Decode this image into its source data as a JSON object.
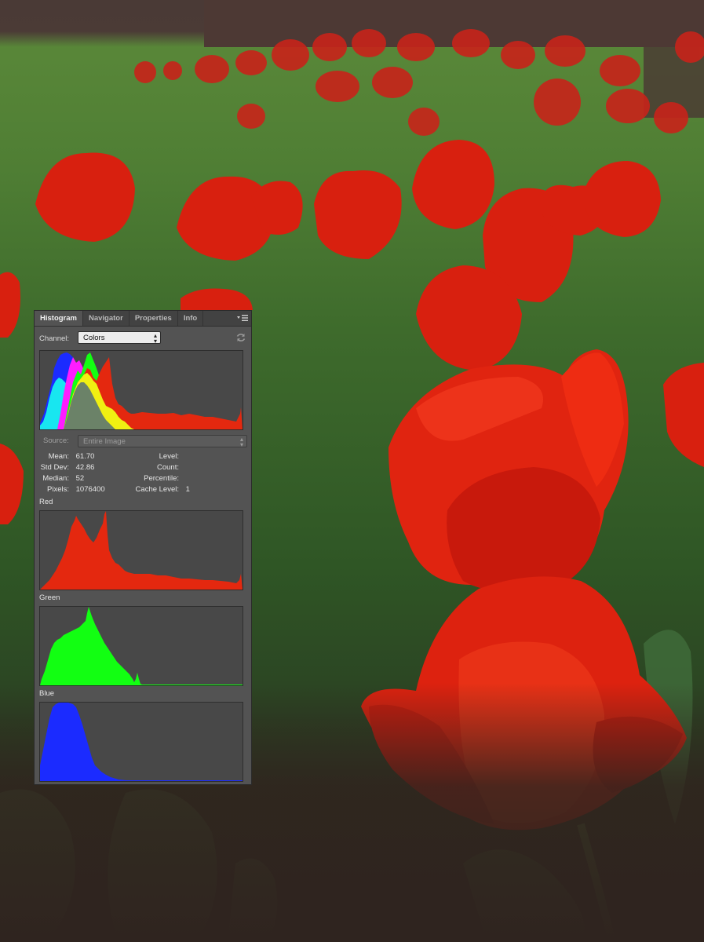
{
  "panel": {
    "tabs": [
      "Histogram",
      "Navigator",
      "Properties",
      "Info"
    ],
    "channel_label": "Channel:",
    "channel_value": "Colors",
    "source_label": "Source:",
    "source_value": "Entire Image",
    "stats_left": [
      {
        "label": "Mean:",
        "value": "61.70"
      },
      {
        "label": "Std Dev:",
        "value": "42.86"
      },
      {
        "label": "Median:",
        "value": "52"
      },
      {
        "label": "Pixels:",
        "value": "1076400"
      }
    ],
    "stats_right": [
      {
        "label": "Level:",
        "value": ""
      },
      {
        "label": "Count:",
        "value": ""
      },
      {
        "label": "Percentile:",
        "value": ""
      },
      {
        "label": "Cache Level:",
        "value": "1"
      }
    ],
    "channels": [
      {
        "name": "Red",
        "color": "#e4280f"
      },
      {
        "name": "Green",
        "color": "#12ff12"
      },
      {
        "name": "Blue",
        "color": "#1b2bff"
      }
    ]
  },
  "icons": {
    "panel_menu": "panel-menu-icon",
    "refresh": "refresh-icon",
    "dropdown": "dropdown-arrows-icon"
  },
  "colors": {
    "panel_bg": "#535353",
    "hist_bg": "#484848",
    "tab_bar": "#424242"
  }
}
